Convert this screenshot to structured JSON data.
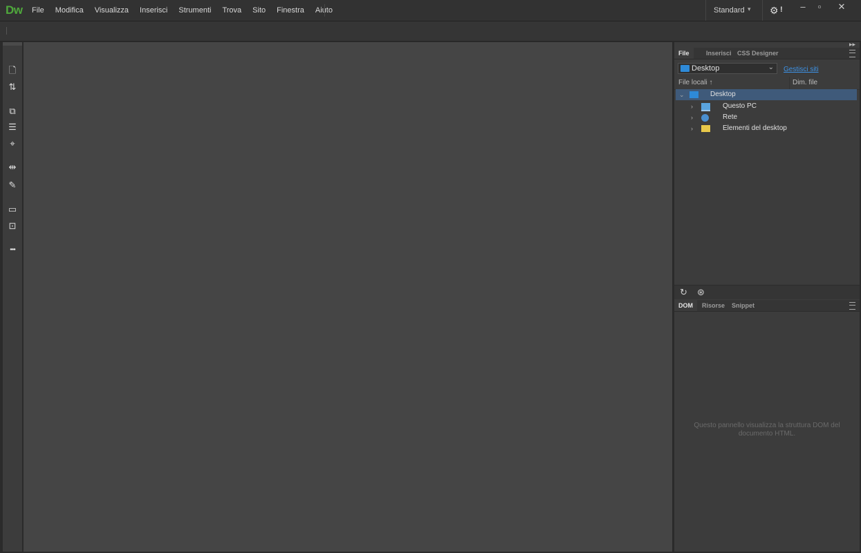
{
  "app": {
    "logo": "Dw"
  },
  "menu": [
    "File",
    "Modifica",
    "Visualizza",
    "Inserisci",
    "Strumenti",
    "Trova",
    "Sito",
    "Finestra",
    "Aiuto"
  ],
  "workspace": {
    "label": "Standard",
    "caret": "▾"
  },
  "sync": {
    "icon": "⚙",
    "badge": "!"
  },
  "window_controls": {
    "minimize": "–",
    "maximize": "▫",
    "close": "✕"
  },
  "left_tools": [
    {
      "name": "new-document-icon",
      "glyph": "🗋"
    },
    {
      "name": "sort-arrows-icon",
      "glyph": "⇅"
    },
    {
      "name": "inspect-icon",
      "glyph": "⧉"
    },
    {
      "name": "dom-outline-icon",
      "glyph": "☰"
    },
    {
      "name": "target-icon",
      "glyph": "⌖"
    },
    {
      "name": "align-icon",
      "glyph": "⇹"
    },
    {
      "name": "brush-icon",
      "glyph": "✎"
    },
    {
      "name": "comment-icon",
      "glyph": "▭"
    },
    {
      "name": "validate-icon",
      "glyph": "⊡"
    },
    {
      "name": "more-icon",
      "glyph": "•••"
    }
  ],
  "panel_top": {
    "tabs": [
      "File",
      "Inserisci",
      "CSS Designer"
    ],
    "site_select": {
      "value": "Desktop",
      "caret": "⌄"
    },
    "manage_link": "Gestisci siti",
    "columns": {
      "name": "File locali ↑",
      "size": "Dim. file"
    },
    "tree": [
      {
        "label": "Desktop",
        "chevron": "⌄",
        "icon": "desktop",
        "selected": true
      },
      {
        "label": "Questo PC",
        "chevron": "›",
        "icon": "pc",
        "selected": false
      },
      {
        "label": "Rete",
        "chevron": "›",
        "icon": "network",
        "selected": false
      },
      {
        "label": "Elementi del desktop",
        "chevron": "›",
        "icon": "folder",
        "selected": false
      }
    ],
    "footer": {
      "refresh": "↻",
      "connect": "⊛"
    }
  },
  "panel_bottom": {
    "tabs": [
      "DOM",
      "Risorse",
      "Snippet"
    ],
    "message": "Questo pannello visualizza la struttura DOM del documento HTML."
  },
  "colors": {
    "logo": "#4fa83c",
    "link": "#3d92e6",
    "selection": "#3f5a7a",
    "folder": "#e8c84a",
    "desktop": "#2e8ad8"
  }
}
